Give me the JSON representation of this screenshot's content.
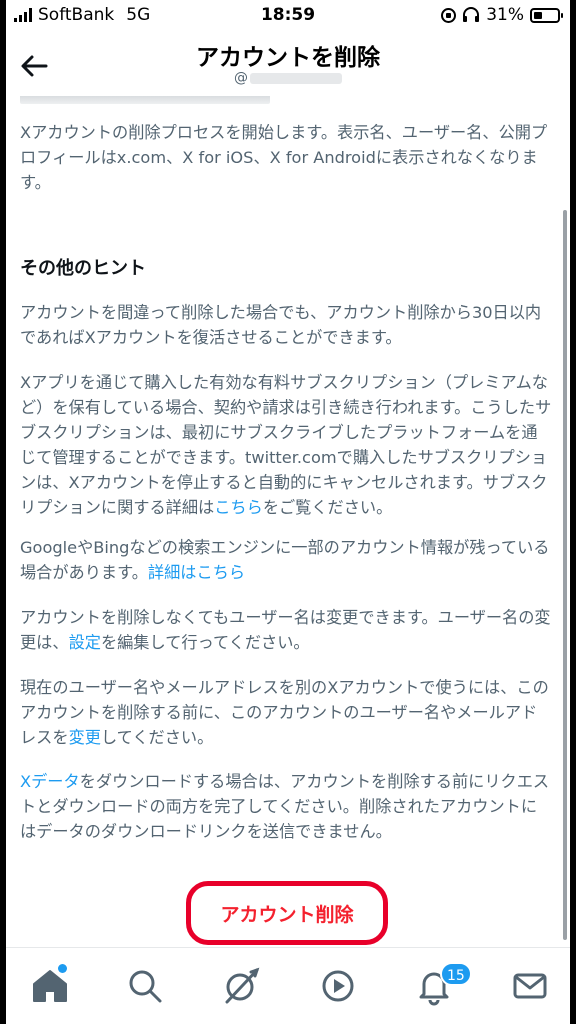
{
  "status_bar": {
    "carrier": "SoftBank",
    "network": "5G",
    "time": "18:59",
    "battery": "31%"
  },
  "header": {
    "title": "アカウントを削除",
    "handle_prefix": "@"
  },
  "content": {
    "intro": "Xアカウントの削除プロセスを開始します。表示名、ユーザー名、公開プロフィールはx.com、X for iOS、X for Androidに表示されなくなります。",
    "tips_heading": "その他のヒント",
    "p1": "アカウントを間違って削除した場合でも、アカウント削除から30日以内であればXアカウントを復活させることができます。",
    "p2_text": "Xアプリを通じて購入した有効な有料サブスクリプション（プレミアムなど）を保有している場合、契約や請求は引き続き行われます。こうしたサブスクリプションは、最初にサブスクライブしたプラットフォームを通じて管理することができます。twitter.comで購入したサブスクリプションは、Xアカウントを停止すると自動的にキャンセルされます。サブスクリプションに関する詳細は",
    "p2_link": "こちら",
    "p2_tail": "をご覧ください。",
    "p3_text": "GoogleやBingなどの検索エンジンに一部のアカウント情報が残っている場合があります。",
    "p3_link": "詳細はこちら",
    "p4_text": "アカウントを削除しなくてもユーザー名は変更できます。ユーザー名の変更は、",
    "p4_link": "設定",
    "p4_tail": "を編集して行ってください。",
    "p5_text": "現在のユーザー名やメールアドレスを別のXアカウントで使うには、このアカウントを削除する前に、このアカウントのユーザー名やメールアドレスを",
    "p5_link": "変更",
    "p5_tail": "してください。",
    "p6_link": "Xデータ",
    "p6_text": "をダウンロードする場合は、アカウントを削除する前にリクエストとダウンロードの両方を完了してください。削除されたアカウントにはデータのダウンロードリンクを送信できません。"
  },
  "delete_button": {
    "label": "アカウント削除",
    "color": "#f4212e"
  },
  "bottom_nav": {
    "items": [
      "home-icon",
      "search-icon",
      "grok-icon",
      "video-icon",
      "notifications-icon",
      "messages-icon"
    ],
    "notification_count": "15"
  }
}
